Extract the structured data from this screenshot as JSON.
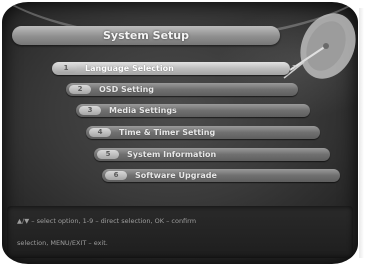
{
  "screen": {
    "title": "System Setup",
    "menu": [
      {
        "number": "1",
        "label": "Language Selection",
        "selected": true
      },
      {
        "number": "2",
        "label": "OSD Setting",
        "selected": false
      },
      {
        "number": "3",
        "label": "Media Settings",
        "selected": false
      },
      {
        "number": "4",
        "label": "Time & Timer Setting",
        "selected": false
      },
      {
        "number": "5",
        "label": "System Information",
        "selected": false
      },
      {
        "number": "6",
        "label": "Software Upgrade",
        "selected": false
      }
    ],
    "pointer_glyph": "?",
    "help": {
      "line1": "▲/▼ – select option, 1-9 – direct selection, OK – confirm",
      "line2": "selection, MENU/EXIT – exit."
    }
  },
  "icons": [
    "satellite-dish-icon"
  ],
  "colors": {
    "background": "#3a3a3a",
    "pill_normal": "#707070",
    "pill_selected": "#bdbdbd",
    "text": "#e8e8e8"
  }
}
